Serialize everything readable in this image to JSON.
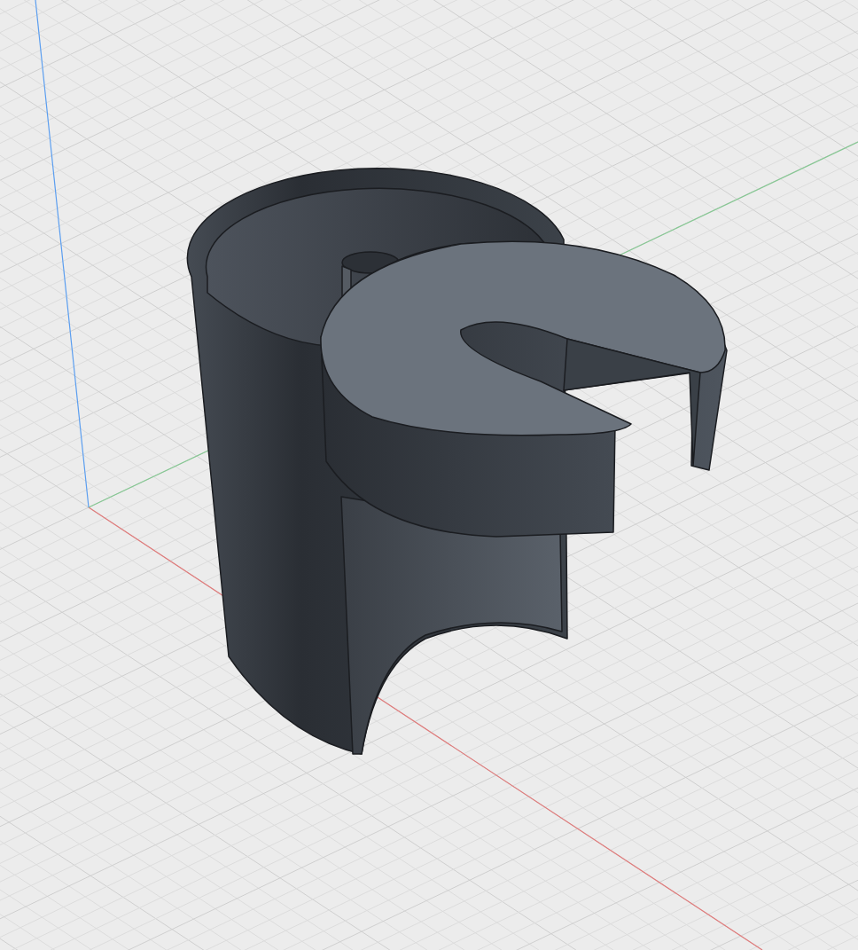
{
  "viewport": {
    "axes": [
      {
        "kind": "x",
        "color": "#e07b7b"
      },
      {
        "kind": "y",
        "color": "#86c893"
      },
      {
        "kind": "z",
        "color": "#5b9ef0"
      }
    ]
  }
}
